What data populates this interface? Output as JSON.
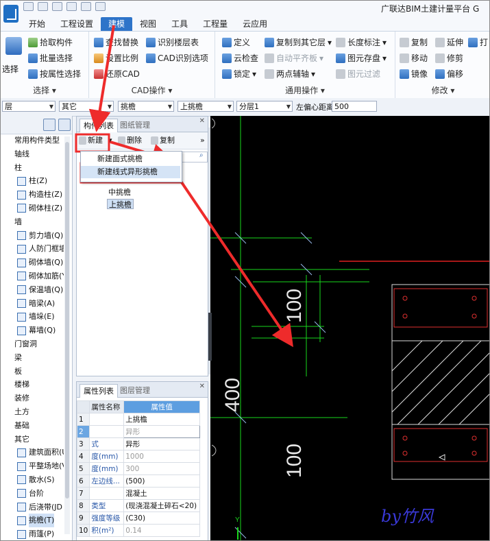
{
  "app": {
    "title": "广联达BIM土建计量平台 G"
  },
  "menu": {
    "items": [
      "开始",
      "工程设置",
      "建模",
      "视图",
      "工具",
      "工程量",
      "云应用"
    ],
    "active_index": 2
  },
  "ribbon": {
    "select_group": {
      "title": "选择",
      "big_button": "选择",
      "items": [
        "拾取构件",
        "批量选择",
        "按属性选择"
      ]
    },
    "cad_group": {
      "title": "CAD操作",
      "items": [
        "查找替换",
        "识别楼层表",
        "设置比例",
        "CAD识别选项",
        "还原CAD"
      ]
    },
    "common_group": {
      "title": "通用操作",
      "items": [
        "定义",
        "复制到其它层",
        "长度标注",
        "云检查",
        "自动平齐板",
        "图元存盘",
        "锁定",
        "两点辅轴",
        "图元过滤"
      ]
    },
    "modify_group": {
      "title": "修改",
      "items": [
        "复制",
        "延伸",
        "打",
        "移动",
        "修剪",
        "镜像",
        "偏移"
      ]
    }
  },
  "propbar": {
    "floor": "层",
    "category": "其它",
    "type": "挑檐",
    "component": "上挑檐",
    "layer": "分层1",
    "offset_label": "左偏心距离:",
    "offset_value": "500"
  },
  "nav": {
    "items": [
      {
        "label": "常用构件类型",
        "kind": "cat"
      },
      {
        "label": "轴线",
        "kind": "cat"
      },
      {
        "label": "柱",
        "kind": "cat"
      },
      {
        "label": "柱(Z)",
        "kind": "sub"
      },
      {
        "label": "构造柱(Z)",
        "kind": "sub"
      },
      {
        "label": "砌体柱(Z)",
        "kind": "sub"
      },
      {
        "label": "墙",
        "kind": "cat"
      },
      {
        "label": "剪力墙(Q)",
        "kind": "sub"
      },
      {
        "label": "人防门框墙",
        "kind": "sub"
      },
      {
        "label": "砌体墙(Q)",
        "kind": "sub"
      },
      {
        "label": "砌体加筋(Y",
        "kind": "sub"
      },
      {
        "label": "保温墙(Q)",
        "kind": "sub"
      },
      {
        "label": "暗梁(A)",
        "kind": "sub"
      },
      {
        "label": "墙垛(E)",
        "kind": "sub"
      },
      {
        "label": "幕墙(Q)",
        "kind": "sub"
      },
      {
        "label": "门窗洞",
        "kind": "cat"
      },
      {
        "label": "梁",
        "kind": "cat"
      },
      {
        "label": "板",
        "kind": "cat"
      },
      {
        "label": "楼梯",
        "kind": "cat"
      },
      {
        "label": "装修",
        "kind": "cat"
      },
      {
        "label": "土方",
        "kind": "cat"
      },
      {
        "label": "基础",
        "kind": "cat"
      },
      {
        "label": "其它",
        "kind": "cat"
      },
      {
        "label": "建筑面积(U",
        "kind": "sub"
      },
      {
        "label": "平整场地(V",
        "kind": "sub"
      },
      {
        "label": "散水(S)",
        "kind": "sub"
      },
      {
        "label": "台阶",
        "kind": "sub"
      },
      {
        "label": "后浇带(JD",
        "kind": "sub"
      },
      {
        "label": "挑檐(T)",
        "kind": "sub",
        "selected": true
      },
      {
        "label": "雨篷(P)",
        "kind": "sub"
      }
    ]
  },
  "component_panel": {
    "tabs": [
      "构件列表",
      "图纸管理"
    ],
    "new_button": "新建",
    "delete_button": "删除",
    "copy_button": "复制",
    "dropdown": [
      "新建面式挑檐",
      "新建线式异形挑檐"
    ],
    "tree": [
      "中挑檐",
      "上挑檐"
    ]
  },
  "property_panel": {
    "tabs": [
      "属性列表",
      "图层管理"
    ],
    "header": [
      "属性名称",
      "属性值"
    ],
    "rows": [
      {
        "n": "1",
        "k": "",
        "v": "上挑檐",
        "gray": false
      },
      {
        "n": "2",
        "k": "",
        "v": "异形",
        "gray": true
      },
      {
        "n": "3",
        "k": "式",
        "v": "异形",
        "gray": false
      },
      {
        "n": "4",
        "k": "度(mm)",
        "v": "1000",
        "gray": true
      },
      {
        "n": "5",
        "k": "度(mm)",
        "v": "300",
        "gray": true
      },
      {
        "n": "6",
        "k": "左边线...",
        "v": "(500)",
        "gray": false
      },
      {
        "n": "7",
        "k": "",
        "v": "混凝土",
        "gray": false
      },
      {
        "n": "8",
        "k": "类型",
        "v": "(现浇混凝土碎石<20)",
        "gray": false
      },
      {
        "n": "9",
        "k": "强度等级",
        "v": "(C30)",
        "gray": false
      },
      {
        "n": "10",
        "k": "积(m²)",
        "v": "0.14",
        "gray": true
      }
    ]
  },
  "cad": {
    "dim_labels": [
      "100",
      "400",
      "100"
    ],
    "watermark": "by竹风"
  },
  "colors": {
    "accent": "#2e74c9",
    "annotation_red": "#ee2b2b",
    "cad_green": "#19d81c",
    "cad_bg": "#000000"
  }
}
